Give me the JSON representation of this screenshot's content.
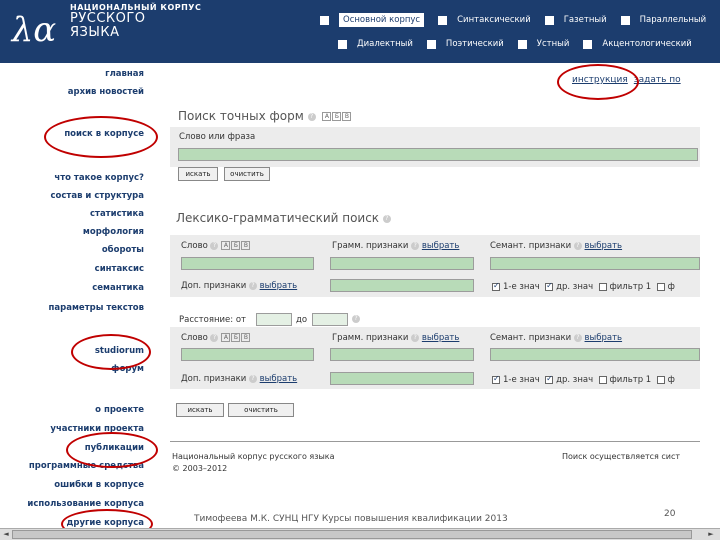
{
  "header": {
    "logo_glyph": "λα",
    "logo_line1": "НАЦИОНАЛЬНЫЙ КОРПУС",
    "logo_line2": "РУССКОГО",
    "logo_line3": "ЯЗЫКА",
    "nav_row1": [
      "Основной корпус",
      "Синтаксический",
      "Газетный",
      "Параллельный"
    ],
    "nav_row2": [
      "Диалектный",
      "Поэтический",
      "Устный",
      "Акцентологический"
    ]
  },
  "sidebar": {
    "items": [
      "главная",
      "архив новостей",
      "поиск в корпусе",
      "что такое корпус?",
      "состав и структура",
      "статистика",
      "морфология",
      "обороты",
      "синтаксис",
      "семантика",
      "параметры текстов",
      "studiorum",
      "форум",
      "о проекте",
      "участники проекта",
      "публикации",
      "программные средства",
      "ошибки в корпусе",
      "использование корпуса",
      "другие корпуса"
    ]
  },
  "content": {
    "links": [
      "инструкция",
      "задать по"
    ],
    "exact": {
      "title": "Поиск точных форм",
      "field_label": "Слово или фраза",
      "search_btn": "искать",
      "clear_btn": "очистить"
    },
    "lexgram": {
      "title": "Лексико-грамматический поиск",
      "word_label": "Слово",
      "gram_label": "Грамм. признаки",
      "sem_label": "Семант. признаки",
      "choose": "выбрать",
      "extra_label": "Доп. признаки",
      "opt1": "1-е знач",
      "opt2": "др. знач",
      "opt3": "фильтр 1",
      "opt4": "ф",
      "distance_label": "Расстояние: от",
      "distance_to": "до",
      "search_btn": "искать",
      "clear_btn": "очистить"
    },
    "kbd_keys": [
      "А",
      "Б",
      "В"
    ]
  },
  "footer": {
    "name": "Национальный корпус русского языка",
    "copyright": "© 2003–2012",
    "right_text": "Поиск осуществляется сист",
    "caption": "Тимофеева М.К. СУНЦ НГУ Курсы повышения квалификации 2013",
    "page_no": "20"
  },
  "colors": {
    "header_bg": "#1c3d6e",
    "field_bg": "#b8dbb8",
    "annotation": "#c00000"
  }
}
